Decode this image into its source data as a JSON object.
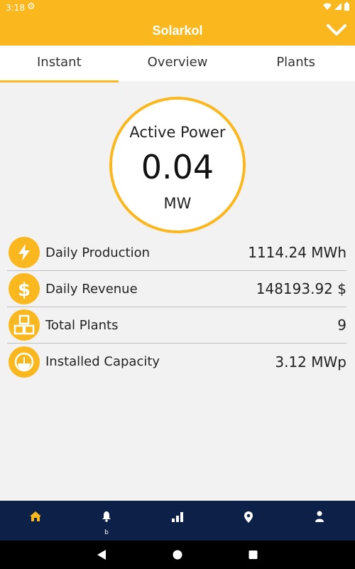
{
  "status_bar": {
    "time": "3:18"
  },
  "app": {
    "title": "Solarkol"
  },
  "tabs": [
    {
      "label": "Instant",
      "active": true
    },
    {
      "label": "Overview",
      "active": false
    },
    {
      "label": "Plants",
      "active": false
    }
  ],
  "active_power": {
    "label": "Active Power",
    "value": "0.04",
    "unit": "MW"
  },
  "stats": [
    {
      "icon": "lightning-icon",
      "label": "Daily Production",
      "value": "1114.24 MWh"
    },
    {
      "icon": "dollar-icon",
      "label": "Daily Revenue",
      "value": "148193.92 $"
    },
    {
      "icon": "plants-icon",
      "label": "Total Plants",
      "value": "9"
    },
    {
      "icon": "gauge-icon",
      "label": "Installed Capacity",
      "value": "3.12 MWp"
    }
  ],
  "bottom_nav": [
    {
      "icon": "home-icon",
      "active": true
    },
    {
      "icon": "bell-icon",
      "sub": "b"
    },
    {
      "icon": "bar-chart-icon"
    },
    {
      "icon": "location-pin-icon"
    },
    {
      "icon": "person-icon"
    }
  ],
  "colors": {
    "accent": "#fbb81e",
    "nav_bg": "#0d2148",
    "active_nav": "#fbb81e"
  }
}
